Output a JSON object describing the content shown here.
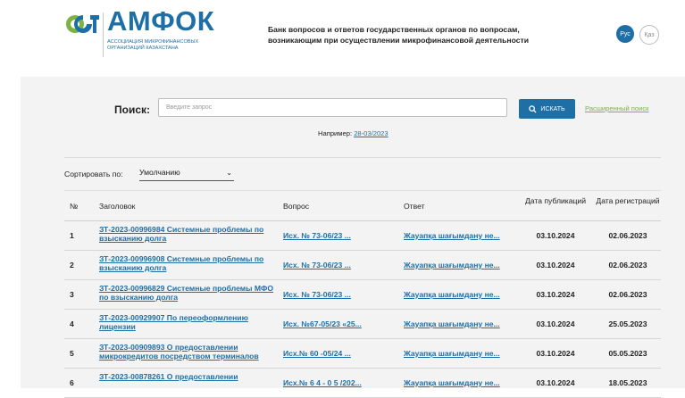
{
  "header": {
    "logo_name": "АМФОК",
    "logo_sub": "Ассоциация микрофинансовых организаций Казахстана",
    "title": "Банк вопросов и ответов государственных органов по вопросам, возникающим при осуществлении микрофинансовой деятельности",
    "lang_ru": "Рус",
    "lang_kz": "Қаз",
    "colors": {
      "brand": "#1d6fa6",
      "accent": "#7cb342"
    }
  },
  "search": {
    "label": "Поиск:",
    "placeholder": "Введите запрос",
    "button_label": "ИСКАТЬ",
    "advanced_label": "Расширенный поиск",
    "example_label": "Например:",
    "example_value": "28-03/2023"
  },
  "sort": {
    "label": "Сортировать по:",
    "selected": "Умолчанию"
  },
  "table": {
    "headers": {
      "num": "№",
      "title": "Заголовок",
      "question": "Вопрос",
      "answer": "Ответ",
      "pub_date": "Дата публикаций",
      "reg_date": "Дата регистраций"
    },
    "rows": [
      {
        "num": "1",
        "title": "ЗТ-2023-00996984 Системные проблемы по взысканию долга",
        "question": "Исх. № 73-06/23 ...",
        "answer": "Жауапқа шағымдану не...",
        "pub": "03.10.2024",
        "reg": "02.06.2023"
      },
      {
        "num": "2",
        "title": "ЗТ-2023-00996908 Системные проблемы по взысканию долга",
        "question": "Исх. № 73-06/23 ...",
        "answer": "Жауапқа шағымдану не...",
        "pub": "03.10.2024",
        "reg": "02.06.2023"
      },
      {
        "num": "3",
        "title": "ЗТ-2023-00996829 Системные проблемы МФО по взысканию долга",
        "question": "Исх. № 73-06/23 ...",
        "answer": "Жауапқа шағымдану не...",
        "pub": "03.10.2024",
        "reg": "02.06.2023"
      },
      {
        "num": "4",
        "title": "ЗТ-2023-00929907 По переоформлению лицензии",
        "question": "Исх. №67-05/23 «25...",
        "answer": "Жауапқа шағымдану не...",
        "pub": "03.10.2024",
        "reg": "25.05.2023"
      },
      {
        "num": "5",
        "title": "ЗТ-2023-00909893 О предоставлении микрокредитов посредством терминалов",
        "question": "Исх.№ 60 -05/24 ...",
        "answer": "Жауапқа шағымдану не...",
        "pub": "03.10.2024",
        "reg": "05.05.2023"
      },
      {
        "num": "6",
        "title": "ЗТ-2023-00878261 О предоставлении",
        "question": "Исх.№ 6 4 - 0 5 /202...",
        "answer": "Жауапқа шағымдану не...",
        "pub": "03.10.2024",
        "reg": "18.05.2023"
      }
    ]
  }
}
